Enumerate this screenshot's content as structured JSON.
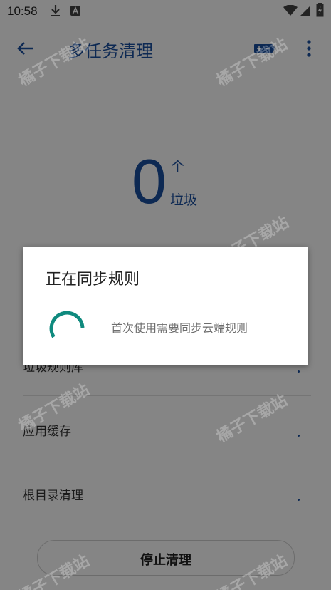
{
  "status_bar": {
    "time": "10:58"
  },
  "app_bar": {
    "title": "多任务清理"
  },
  "counter": {
    "value": "0",
    "unit": "个",
    "label": "垃圾"
  },
  "list": [
    {
      "label": "垃圾规则库"
    },
    {
      "label": "应用缓存"
    },
    {
      "label": "根目录清理"
    }
  ],
  "stop_button": {
    "label": "停止清理"
  },
  "dialog": {
    "title": "正在同步规则",
    "message": "首次使用需要同步云端规则"
  },
  "watermark": "橘子下载站",
  "colors": {
    "accent": "#1a4fa0",
    "spinner": "#0f8a7e",
    "overlay": "rgba(0,0,0,0.48)"
  }
}
